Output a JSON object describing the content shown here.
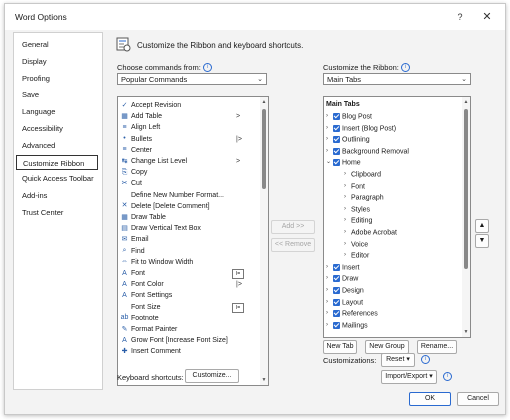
{
  "window": {
    "title": "Word Options",
    "help": "?",
    "close": "✕"
  },
  "sidebar": [
    "General",
    "Display",
    "Proofing",
    "Save",
    "Language",
    "Accessibility",
    "Advanced",
    "Customize Ribbon",
    "Quick Access Toolbar",
    "Add-ins",
    "Trust Center"
  ],
  "selected_sidebar": "Customize Ribbon",
  "header": {
    "text": "Customize the Ribbon and keyboard shortcuts."
  },
  "left": {
    "label": "Choose commands from:",
    "combo": "Popular Commands",
    "items": [
      {
        "label": "Accept Revision",
        "sub": ""
      },
      {
        "label": "Add Table",
        "sub": ">"
      },
      {
        "label": "Align Left",
        "sub": ""
      },
      {
        "label": "Bullets",
        "sub": "|>"
      },
      {
        "label": "Center",
        "sub": ""
      },
      {
        "label": "Change List Level",
        "sub": ">"
      },
      {
        "label": "Copy",
        "sub": ""
      },
      {
        "label": "Cut",
        "sub": ""
      },
      {
        "label": "Define New Number Format...",
        "sub": ""
      },
      {
        "label": "Delete [Delete Comment]",
        "sub": ""
      },
      {
        "label": "Draw Table",
        "sub": ""
      },
      {
        "label": "Draw Vertical Text Box",
        "sub": ""
      },
      {
        "label": "Email",
        "sub": ""
      },
      {
        "label": "Find",
        "sub": ""
      },
      {
        "label": "Fit to Window Width",
        "sub": ""
      },
      {
        "label": "Font",
        "sub": "I="
      },
      {
        "label": "Font Color",
        "sub": "|>"
      },
      {
        "label": "Font Settings",
        "sub": ""
      },
      {
        "label": "Font Size",
        "sub": "I="
      },
      {
        "label": "Footnote",
        "sub": ""
      },
      {
        "label": "Format Painter",
        "sub": ""
      },
      {
        "label": "Grow Font [Increase Font Size]",
        "sub": ""
      },
      {
        "label": "Insert Comment",
        "sub": ""
      }
    ]
  },
  "middle": {
    "add": "Add >>",
    "remove": "<< Remove"
  },
  "right": {
    "label": "Customize the Ribbon:",
    "combo": "Main Tabs",
    "header": "Main Tabs",
    "items": [
      {
        "label": "Blog Post",
        "level": 1,
        "check": true
      },
      {
        "label": "Insert (Blog Post)",
        "level": 1,
        "check": true
      },
      {
        "label": "Outlining",
        "level": 1,
        "check": true
      },
      {
        "label": "Background Removal",
        "level": 1,
        "check": true
      },
      {
        "label": "Home",
        "level": 1,
        "check": true,
        "open": true
      },
      {
        "label": "Clipboard",
        "level": 2,
        "check": false
      },
      {
        "label": "Font",
        "level": 2,
        "check": false
      },
      {
        "label": "Paragraph",
        "level": 2,
        "check": false
      },
      {
        "label": "Styles",
        "level": 2,
        "check": false
      },
      {
        "label": "Editing",
        "level": 2,
        "check": false
      },
      {
        "label": "Adobe Acrobat",
        "level": 2,
        "check": false
      },
      {
        "label": "Voice",
        "level": 2,
        "check": false
      },
      {
        "label": "Editor",
        "level": 2,
        "check": false
      },
      {
        "label": "Insert",
        "level": 1,
        "check": true
      },
      {
        "label": "Draw",
        "level": 1,
        "check": true
      },
      {
        "label": "Design",
        "level": 1,
        "check": true
      },
      {
        "label": "Layout",
        "level": 1,
        "check": true
      },
      {
        "label": "References",
        "level": 1,
        "check": true
      },
      {
        "label": "Mailings",
        "level": 1,
        "check": true
      }
    ],
    "new_tab": "New Tab",
    "new_group": "New Group",
    "rename": "Rename...",
    "customizations": "Customizations:",
    "reset": "Reset",
    "import_export": "Import/Export"
  },
  "keyboard": {
    "label": "Keyboard shortcuts:",
    "button": "Customize..."
  },
  "footer": {
    "ok": "OK",
    "cancel": "Cancel"
  }
}
